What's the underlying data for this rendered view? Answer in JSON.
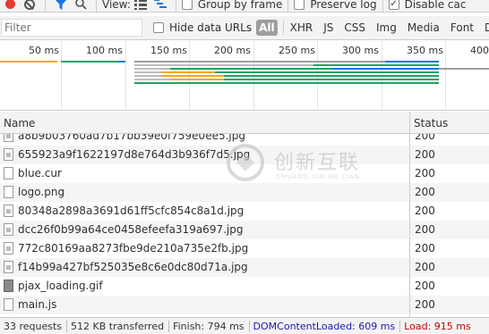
{
  "toolbar": {
    "view_label": "View:",
    "group_by_frame_label": "Group by frame",
    "preserve_log_label": "Preserve log",
    "disable_cache_label": "Disable cac",
    "preserve_log_checked": "✓",
    "disable_cache_checked": "✓"
  },
  "filter": {
    "placeholder": "Filter",
    "hide_data_urls_label": "Hide data URLs",
    "types": [
      "All",
      "XHR",
      "JS",
      "CSS",
      "Img",
      "Media",
      "Font",
      "Doc",
      "W"
    ]
  },
  "overview": {
    "ticks": [
      "50 ms",
      "100 ms",
      "150 ms",
      "200 ms",
      "250 ms",
      "300 ms",
      "350 ms",
      "400"
    ],
    "colors": {
      "blue": "#1a73e8",
      "orange": "#f5a623",
      "green": "#1fa463",
      "gray": "#9e9e9e",
      "purple": "#7b1fa2"
    }
  },
  "table": {
    "col_name": "Name",
    "col_status": "Status",
    "rows": [
      {
        "name": "a8b9b03760ad7b17bb39e0f759e0ee5.jpg",
        "status": "200",
        "icon": "image-file-icon"
      },
      {
        "name": "655923a9f1622197d8e764d3b936f7d5.jpg",
        "status": "200",
        "icon": "image-file-icon"
      },
      {
        "name": "blue.cur",
        "status": "200",
        "icon": "file-icon"
      },
      {
        "name": "logo.png",
        "status": "200",
        "icon": "file-icon"
      },
      {
        "name": "80348a2898a3691d61ff5cfc854c8a1d.jpg",
        "status": "200",
        "icon": "image-file-icon"
      },
      {
        "name": "dcc26f0b99a64ce0458efeefa319a697.jpg",
        "status": "200",
        "icon": "image-file-icon"
      },
      {
        "name": "772c80169aa8273fbe9de210a735e2fb.jpg",
        "status": "200",
        "icon": "image-file-icon"
      },
      {
        "name": "f14b99a427bf525035e8c6e0dc80d71a.jpg",
        "status": "200",
        "icon": "image-file-icon"
      },
      {
        "name": "pjax_loading.gif",
        "status": "200",
        "icon": "gif-file-icon"
      },
      {
        "name": "main.js",
        "status": "200",
        "icon": "file-icon"
      }
    ]
  },
  "watermark": {
    "text": "创新互联",
    "subtext": "CHUANG XIN HU LIAN"
  },
  "statusbar": {
    "requests": "33 requests",
    "transferred": "512 KB transferred",
    "finish": "Finish: 794 ms",
    "dom_content_loaded": "DOMContentLoaded: 609 ms",
    "load": "Load: 915 ms"
  }
}
